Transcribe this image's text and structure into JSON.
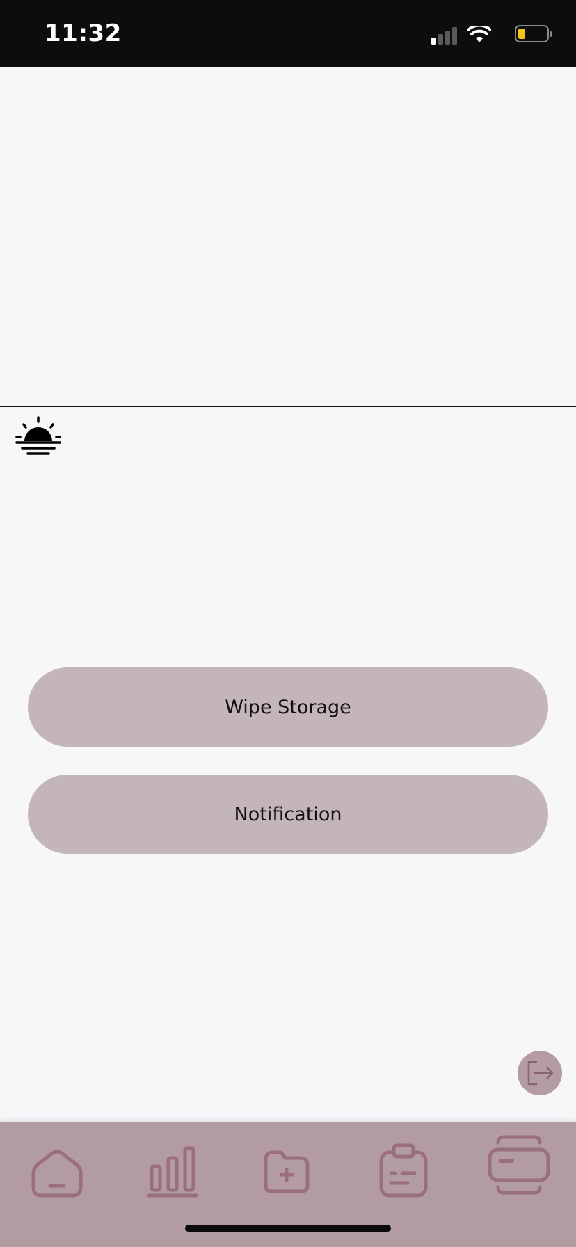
{
  "status_bar": {
    "time": "11:32"
  },
  "colors": {
    "status_bar_bg": "#0d0d0f",
    "page_bg": "#f7f7fa",
    "button_bg": "#c4b5bd",
    "tab_bar_bg": "#b39ba2",
    "tab_icon": "#9a6e7c",
    "battery_fill": "#f5c518"
  },
  "actions": {
    "wipe_storage_label": "Wipe Storage",
    "notification_label": "Notification"
  },
  "icons": {
    "theme": "sunset-icon",
    "logout": "logout-icon",
    "tabs": [
      "home-icon",
      "stats-icon",
      "folder-add-icon",
      "clipboard-icon",
      "card-icon"
    ]
  }
}
